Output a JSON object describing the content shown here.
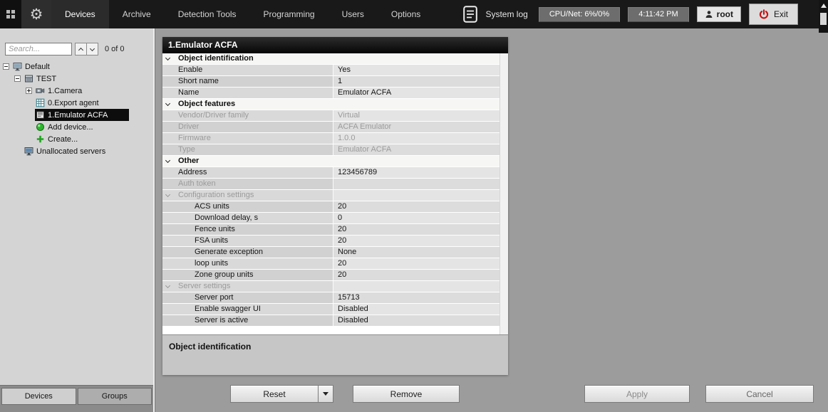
{
  "topbar": {
    "tabs": [
      {
        "label": "Devices",
        "active": true
      },
      {
        "label": "Archive",
        "active": false
      },
      {
        "label": "Detection Tools",
        "active": false
      },
      {
        "label": "Programming",
        "active": false
      },
      {
        "label": "Users",
        "active": false
      },
      {
        "label": "Options",
        "active": false
      }
    ],
    "system_log_label": "System log",
    "cpu_net": "CPU/Net: 6%/0%",
    "time": "4:11:42 PM",
    "user": "root",
    "exit_label": "Exit"
  },
  "sidebar": {
    "search_placeholder": "Search...",
    "result_count": "0 of 0",
    "tree": [
      {
        "label": "Default",
        "level": 0,
        "icon": "computer",
        "expander": "minus",
        "selected": false
      },
      {
        "label": "TEST",
        "level": 1,
        "icon": "server",
        "expander": "minus",
        "selected": false
      },
      {
        "label": "1.Camera",
        "level": 2,
        "icon": "camera",
        "expander": "plus",
        "selected": false
      },
      {
        "label": "0.Export agent",
        "level": 2,
        "icon": "export-agent",
        "selected": false
      },
      {
        "label": "1.Emulator ACFA",
        "level": 2,
        "icon": "emulator",
        "selected": true
      },
      {
        "label": "Add device...",
        "level": 2,
        "icon": "add-device",
        "selected": false
      },
      {
        "label": "Create...",
        "level": 2,
        "icon": "create",
        "selected": false
      },
      {
        "label": "Unallocated servers",
        "level": 1,
        "icon": "unallocated-servers",
        "selected": false
      }
    ],
    "bottom_tabs": [
      {
        "label": "Devices",
        "active": true
      },
      {
        "label": "Groups",
        "active": false
      }
    ]
  },
  "panel": {
    "title": "1.Emulator ACFA",
    "rows": [
      {
        "type": "section",
        "label": "Object identification"
      },
      {
        "type": "prop",
        "label": "Enable",
        "value": "Yes"
      },
      {
        "type": "prop",
        "label": "Short name",
        "value": "1"
      },
      {
        "type": "prop",
        "label": "Name",
        "value": "Emulator ACFA"
      },
      {
        "type": "section",
        "label": "Object features"
      },
      {
        "type": "prop",
        "label": "Vendor/Driver family",
        "value": "Virtual",
        "muted": true
      },
      {
        "type": "prop",
        "label": "Driver",
        "value": "ACFA Emulator",
        "muted": true
      },
      {
        "type": "prop",
        "label": "Firmware",
        "value": "1.0.0",
        "muted": true
      },
      {
        "type": "prop",
        "label": "Type",
        "value": "Emulator ACFA",
        "muted": true
      },
      {
        "type": "section",
        "label": "Other"
      },
      {
        "type": "prop",
        "label": "Address",
        "value": "123456789"
      },
      {
        "type": "prop",
        "label": "Auth token",
        "value": "",
        "muted": true
      },
      {
        "type": "group",
        "label": "Configuration settings"
      },
      {
        "type": "prop",
        "label": "ACS units",
        "value": "20",
        "indent": 2
      },
      {
        "type": "prop",
        "label": "Download delay, s",
        "value": "0",
        "indent": 2
      },
      {
        "type": "prop",
        "label": "Fence units",
        "value": "20",
        "indent": 2
      },
      {
        "type": "prop",
        "label": "FSA units",
        "value": "20",
        "indent": 2
      },
      {
        "type": "prop",
        "label": "Generate exception",
        "value": "None",
        "indent": 2
      },
      {
        "type": "prop",
        "label": "loop units",
        "value": "20",
        "indent": 2
      },
      {
        "type": "prop",
        "label": "Zone group units",
        "value": "20",
        "indent": 2
      },
      {
        "type": "group",
        "label": "Server settings"
      },
      {
        "type": "prop",
        "label": "Server port",
        "value": "15713",
        "indent": 2
      },
      {
        "type": "prop",
        "label": "Enable swagger UI",
        "value": "Disabled",
        "indent": 2
      },
      {
        "type": "prop",
        "label": "Server is active",
        "value": "Disabled",
        "indent": 2
      }
    ],
    "description_title": "Object identification"
  },
  "actions": {
    "reset": "Reset",
    "remove": "Remove",
    "apply": "Apply",
    "cancel": "Cancel"
  },
  "colors": {
    "selected_item_bg": "#0d0d0d",
    "exit_icon_red": "#c81414",
    "create_icon_green": "#1fa31f",
    "topbar_bg": "#191919"
  }
}
